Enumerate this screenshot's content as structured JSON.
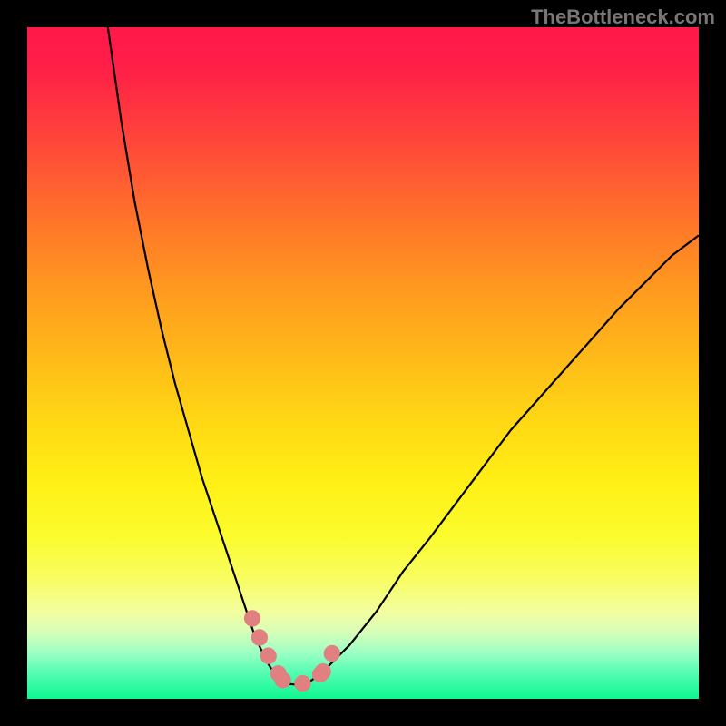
{
  "watermark": "TheBottleneck.com",
  "chart_data": {
    "type": "line",
    "title": "",
    "xlabel": "",
    "ylabel": "",
    "xlim": [
      0,
      100
    ],
    "ylim": [
      0,
      100
    ],
    "grid": false,
    "legend": false,
    "series": [
      {
        "name": "left-curve",
        "color": "#000000",
        "x": [
          12,
          14,
          16,
          18,
          20,
          22,
          24,
          26,
          28,
          30,
          32,
          33,
          34,
          35,
          36,
          37,
          38
        ],
        "y": [
          100,
          86,
          74,
          64,
          55,
          47,
          40,
          33,
          27,
          21,
          15,
          12,
          9,
          7,
          5,
          3.5,
          2.5
        ]
      },
      {
        "name": "right-curve",
        "color": "#000000",
        "x": [
          42,
          44,
          46,
          48,
          52,
          56,
          60,
          66,
          72,
          80,
          88,
          96,
          100
        ],
        "y": [
          2.5,
          4,
          6,
          8,
          13,
          19,
          24,
          32,
          40,
          49,
          58,
          66,
          69
        ]
      },
      {
        "name": "bottom-valley",
        "color": "#000000",
        "x": [
          38,
          39,
          40,
          41,
          42
        ],
        "y": [
          2.5,
          2.2,
          2.1,
          2.2,
          2.5
        ]
      },
      {
        "name": "pink-left-segment",
        "color": "#e08080",
        "x": [
          33.5,
          34.2,
          35.0,
          35.8,
          36.5,
          37.2,
          38.0
        ],
        "y": [
          12.0,
          10.0,
          8.2,
          6.6,
          5.2,
          4.0,
          3.0
        ]
      },
      {
        "name": "pink-bottom-segment",
        "color": "#e08080",
        "x": [
          38.0,
          39.0,
          40.0,
          41.0,
          42.0,
          43.0,
          44.0
        ],
        "y": [
          2.8,
          2.5,
          2.3,
          2.3,
          2.5,
          3.0,
          4.0
        ]
      },
      {
        "name": "pink-right-segment",
        "color": "#e08080",
        "x": [
          44.0,
          44.5,
          45.0,
          45.5,
          46.0
        ],
        "y": [
          4.0,
          5.0,
          6.0,
          7.0,
          8.0
        ]
      }
    ],
    "gradient_stops": [
      {
        "pos": 0.0,
        "color": "#ff184a"
      },
      {
        "pos": 0.5,
        "color": "#ffc617"
      },
      {
        "pos": 0.8,
        "color": "#f8fd60"
      },
      {
        "pos": 1.0,
        "color": "#0df790"
      }
    ]
  }
}
